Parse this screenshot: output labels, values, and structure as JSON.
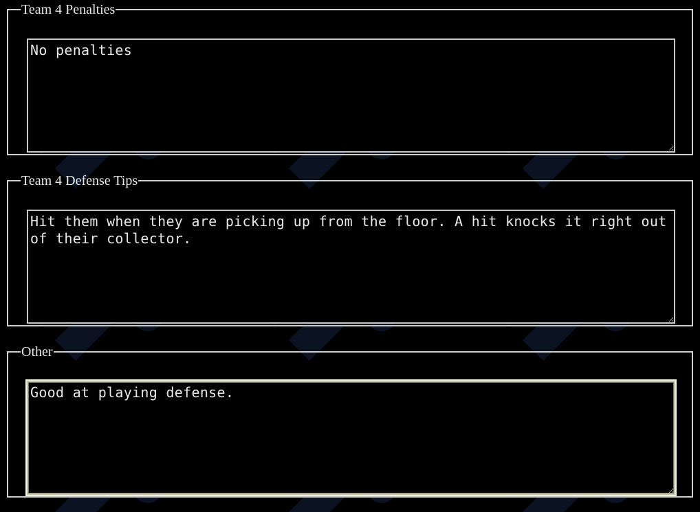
{
  "sections": [
    {
      "legend": "Team 4 Penalties",
      "value": "No penalties"
    },
    {
      "legend": "Team 4 Defense Tips",
      "value": "Hit them when they are picking up from the floor. A hit knocks it right out of their collector."
    },
    {
      "legend": "Other",
      "value": "Good at playing defense."
    }
  ],
  "colors": {
    "background": "#000000",
    "border": "#d0d0d0",
    "text": "#e8e8e8",
    "watermark": "#0a1020"
  },
  "icons": {
    "background": "team-logo-watermark-icon",
    "resize": "resize-grip-icon"
  }
}
